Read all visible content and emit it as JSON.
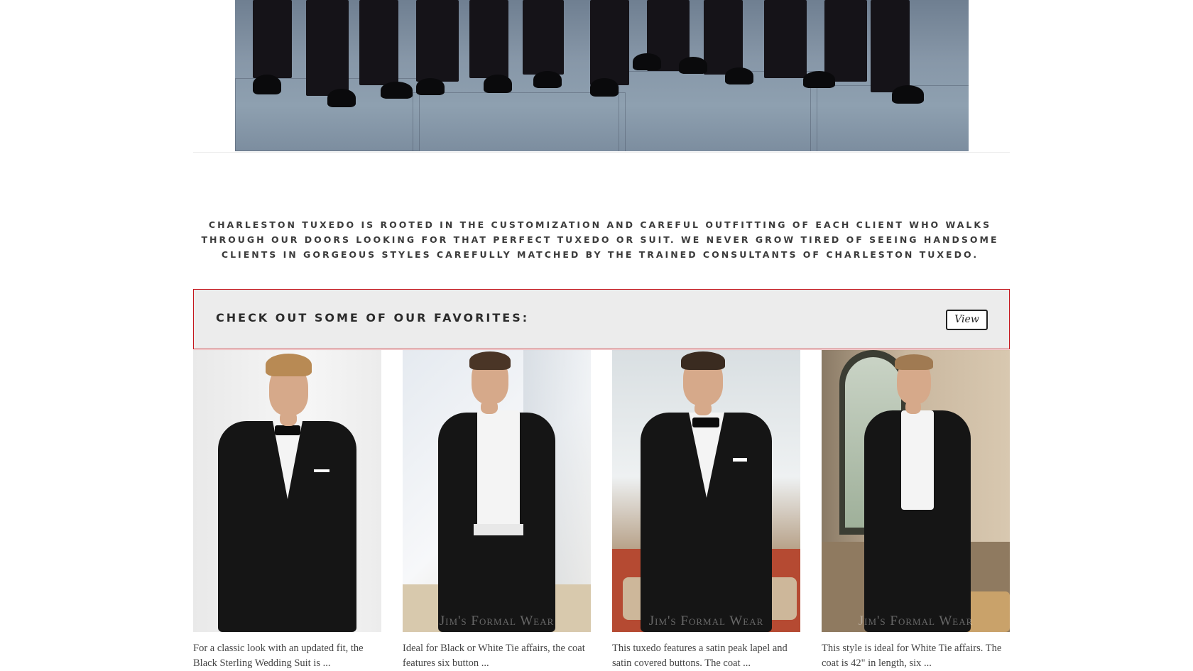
{
  "intro_text": "Charleston Tuxedo is rooted in the customization and careful outfitting of each client who walks through our doors looking for that perfect tuxedo or suit. We never grow tired of seeing handsome clients in gorgeous styles carefully matched by the trained consultants of Charleston Tuxedo.",
  "favorites": {
    "title": "Check out some of our favorites:",
    "view_label": "View"
  },
  "products": [
    {
      "description": "For a classic look with an updated fit, the Black Sterling Wedding Suit is ...",
      "watermark": ""
    },
    {
      "description": "Ideal for Black or White Tie affairs, the coat features six button ...",
      "watermark": "Jim's Formal Wear"
    },
    {
      "description": "This tuxedo features a satin peak lapel and satin covered buttons. The coat ...",
      "watermark": "Jim's Formal Wear"
    },
    {
      "description": "This style is ideal for White Tie affairs. The coat is 42\" in length, six ...",
      "watermark": "Jim's Formal Wear"
    }
  ],
  "colors": {
    "accent_border": "#c4161c",
    "bar_background": "#ececec"
  }
}
